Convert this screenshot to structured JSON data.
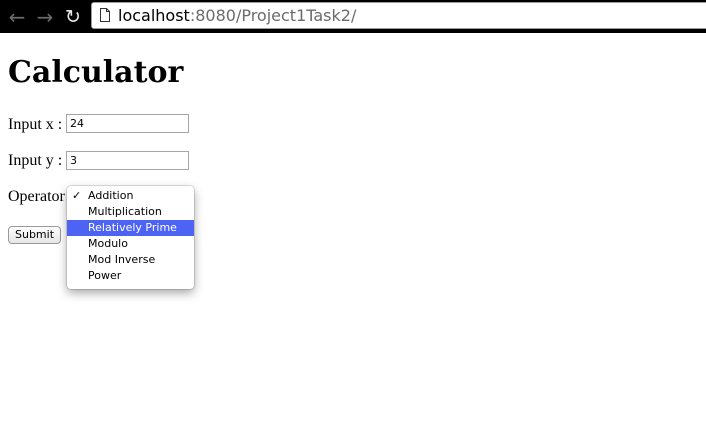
{
  "browser": {
    "url_host": "localhost",
    "url_rest": ":8080/Project1Task2/",
    "back_icon": "back-arrow-icon",
    "forward_icon": "forward-arrow-icon",
    "reload_icon": "reload-icon"
  },
  "page": {
    "title": "Calculator",
    "input_x_label": "Input x :",
    "input_x_value": "24",
    "input_y_label": "Input y :",
    "input_y_value": "3",
    "operator_label": "Operator",
    "submit_label": "Submit"
  },
  "operator_menu": {
    "selected": "Addition",
    "highlighted": "Relatively Prime",
    "check_glyph": "✓",
    "options": [
      "Addition",
      "Multiplication",
      "Relatively Prime",
      "Modulo",
      "Mod Inverse",
      "Power"
    ]
  },
  "colors": {
    "toolbar": "#000000",
    "highlight": "#4c63f3"
  }
}
